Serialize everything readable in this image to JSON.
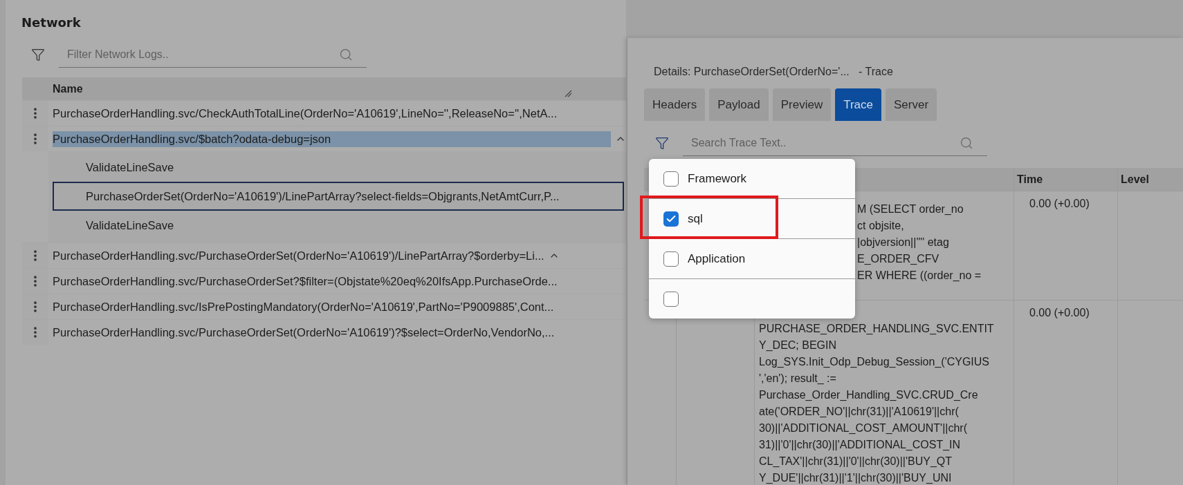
{
  "network": {
    "title": "Network",
    "filter": {
      "placeholder": "Filter Network Logs.."
    },
    "table": {
      "columns": [
        "Name"
      ],
      "rows": [
        {
          "name": "PurchaseOrderHandling.svc/CheckAuthTotalLine(OrderNo='A10619',LineNo='',ReleaseNo='',NetA...",
          "selected": false,
          "expanded": false
        },
        {
          "name": "PurchaseOrderHandling.svc/$batch?odata-debug=json",
          "selected": true,
          "expanded": true,
          "children": [
            {
              "name": "ValidateLineSave",
              "focused": false
            },
            {
              "name": "PurchaseOrderSet(OrderNo='A10619')/LinePartArray?select-fields=Objgrants,NetAmtCurr,P...",
              "focused": true
            },
            {
              "name": "ValidateLineSave",
              "focused": false
            }
          ]
        },
        {
          "name": "PurchaseOrderHandling.svc/PurchaseOrderSet(OrderNo='A10619')/LinePartArray?$orderby=Li...",
          "selected": false,
          "expanded": true
        },
        {
          "name": "PurchaseOrderHandling.svc/PurchaseOrderSet?$filter=(Objstate%20eq%20IfsApp.PurchaseOrde...",
          "selected": false,
          "expanded": false
        },
        {
          "name": "PurchaseOrderHandling.svc/IsPrePostingMandatory(OrderNo='A10619',PartNo='P9009885',Cont...",
          "selected": false,
          "expanded": false
        },
        {
          "name": "PurchaseOrderHandling.svc/PurchaseOrderSet(OrderNo='A10619')?$select=OrderNo,VendorNo,...",
          "selected": false,
          "expanded": false
        }
      ]
    }
  },
  "details": {
    "title": "Details: PurchaseOrderSet(OrderNo='...   - Trace",
    "tabs": [
      {
        "label": "Headers",
        "selected": false
      },
      {
        "label": "Payload",
        "selected": false
      },
      {
        "label": "Preview",
        "selected": false
      },
      {
        "label": "Trace",
        "selected": true
      },
      {
        "label": "Server",
        "selected": false
      }
    ],
    "search": {
      "placeholder": "Search Trace Text.."
    },
    "filter_menu": {
      "open": true,
      "items": [
        {
          "label": "Framework",
          "checked": false
        },
        {
          "label": "sql",
          "checked": true
        },
        {
          "label": "Application",
          "checked": false
        },
        {
          "checked": false
        }
      ]
    },
    "trace_table": {
      "columns": [
        "Time",
        "Level"
      ],
      "rows": [
        {
          "message_lines": [
            "M (SELECT order_no",
            "ct objsite,",
            "|objversion||'\"' etag",
            "E_ORDER_CFV",
            "ER WHERE ((order_no ="
          ],
          "time": "0.00 (+0.00)"
        },
        {
          "message_lines": [
            "PURCHASE_ORDER_HANDLING_SVC.ENTIT",
            "Y_DEC; BEGIN",
            "Log_SYS.Init_Odp_Debug_Session_('CYGIUS",
            "','en'); result_ :=",
            "Purchase_Order_Handling_SVC.CRUD_Cre",
            "ate('ORDER_NO'||chr(31)||'A10619'||chr(",
            "30)||'ADDITIONAL_COST_AMOUNT'||chr(",
            "31)||'0'||chr(30)||'ADDITIONAL_COST_IN",
            "CL_TAX'||chr(31)||'0'||chr(30)||'BUY_QT",
            "Y_DUE'||chr(31)||'1'||chr(30)||'BUY_UNI"
          ],
          "time": "0.00 (+0.00)"
        }
      ]
    }
  }
}
